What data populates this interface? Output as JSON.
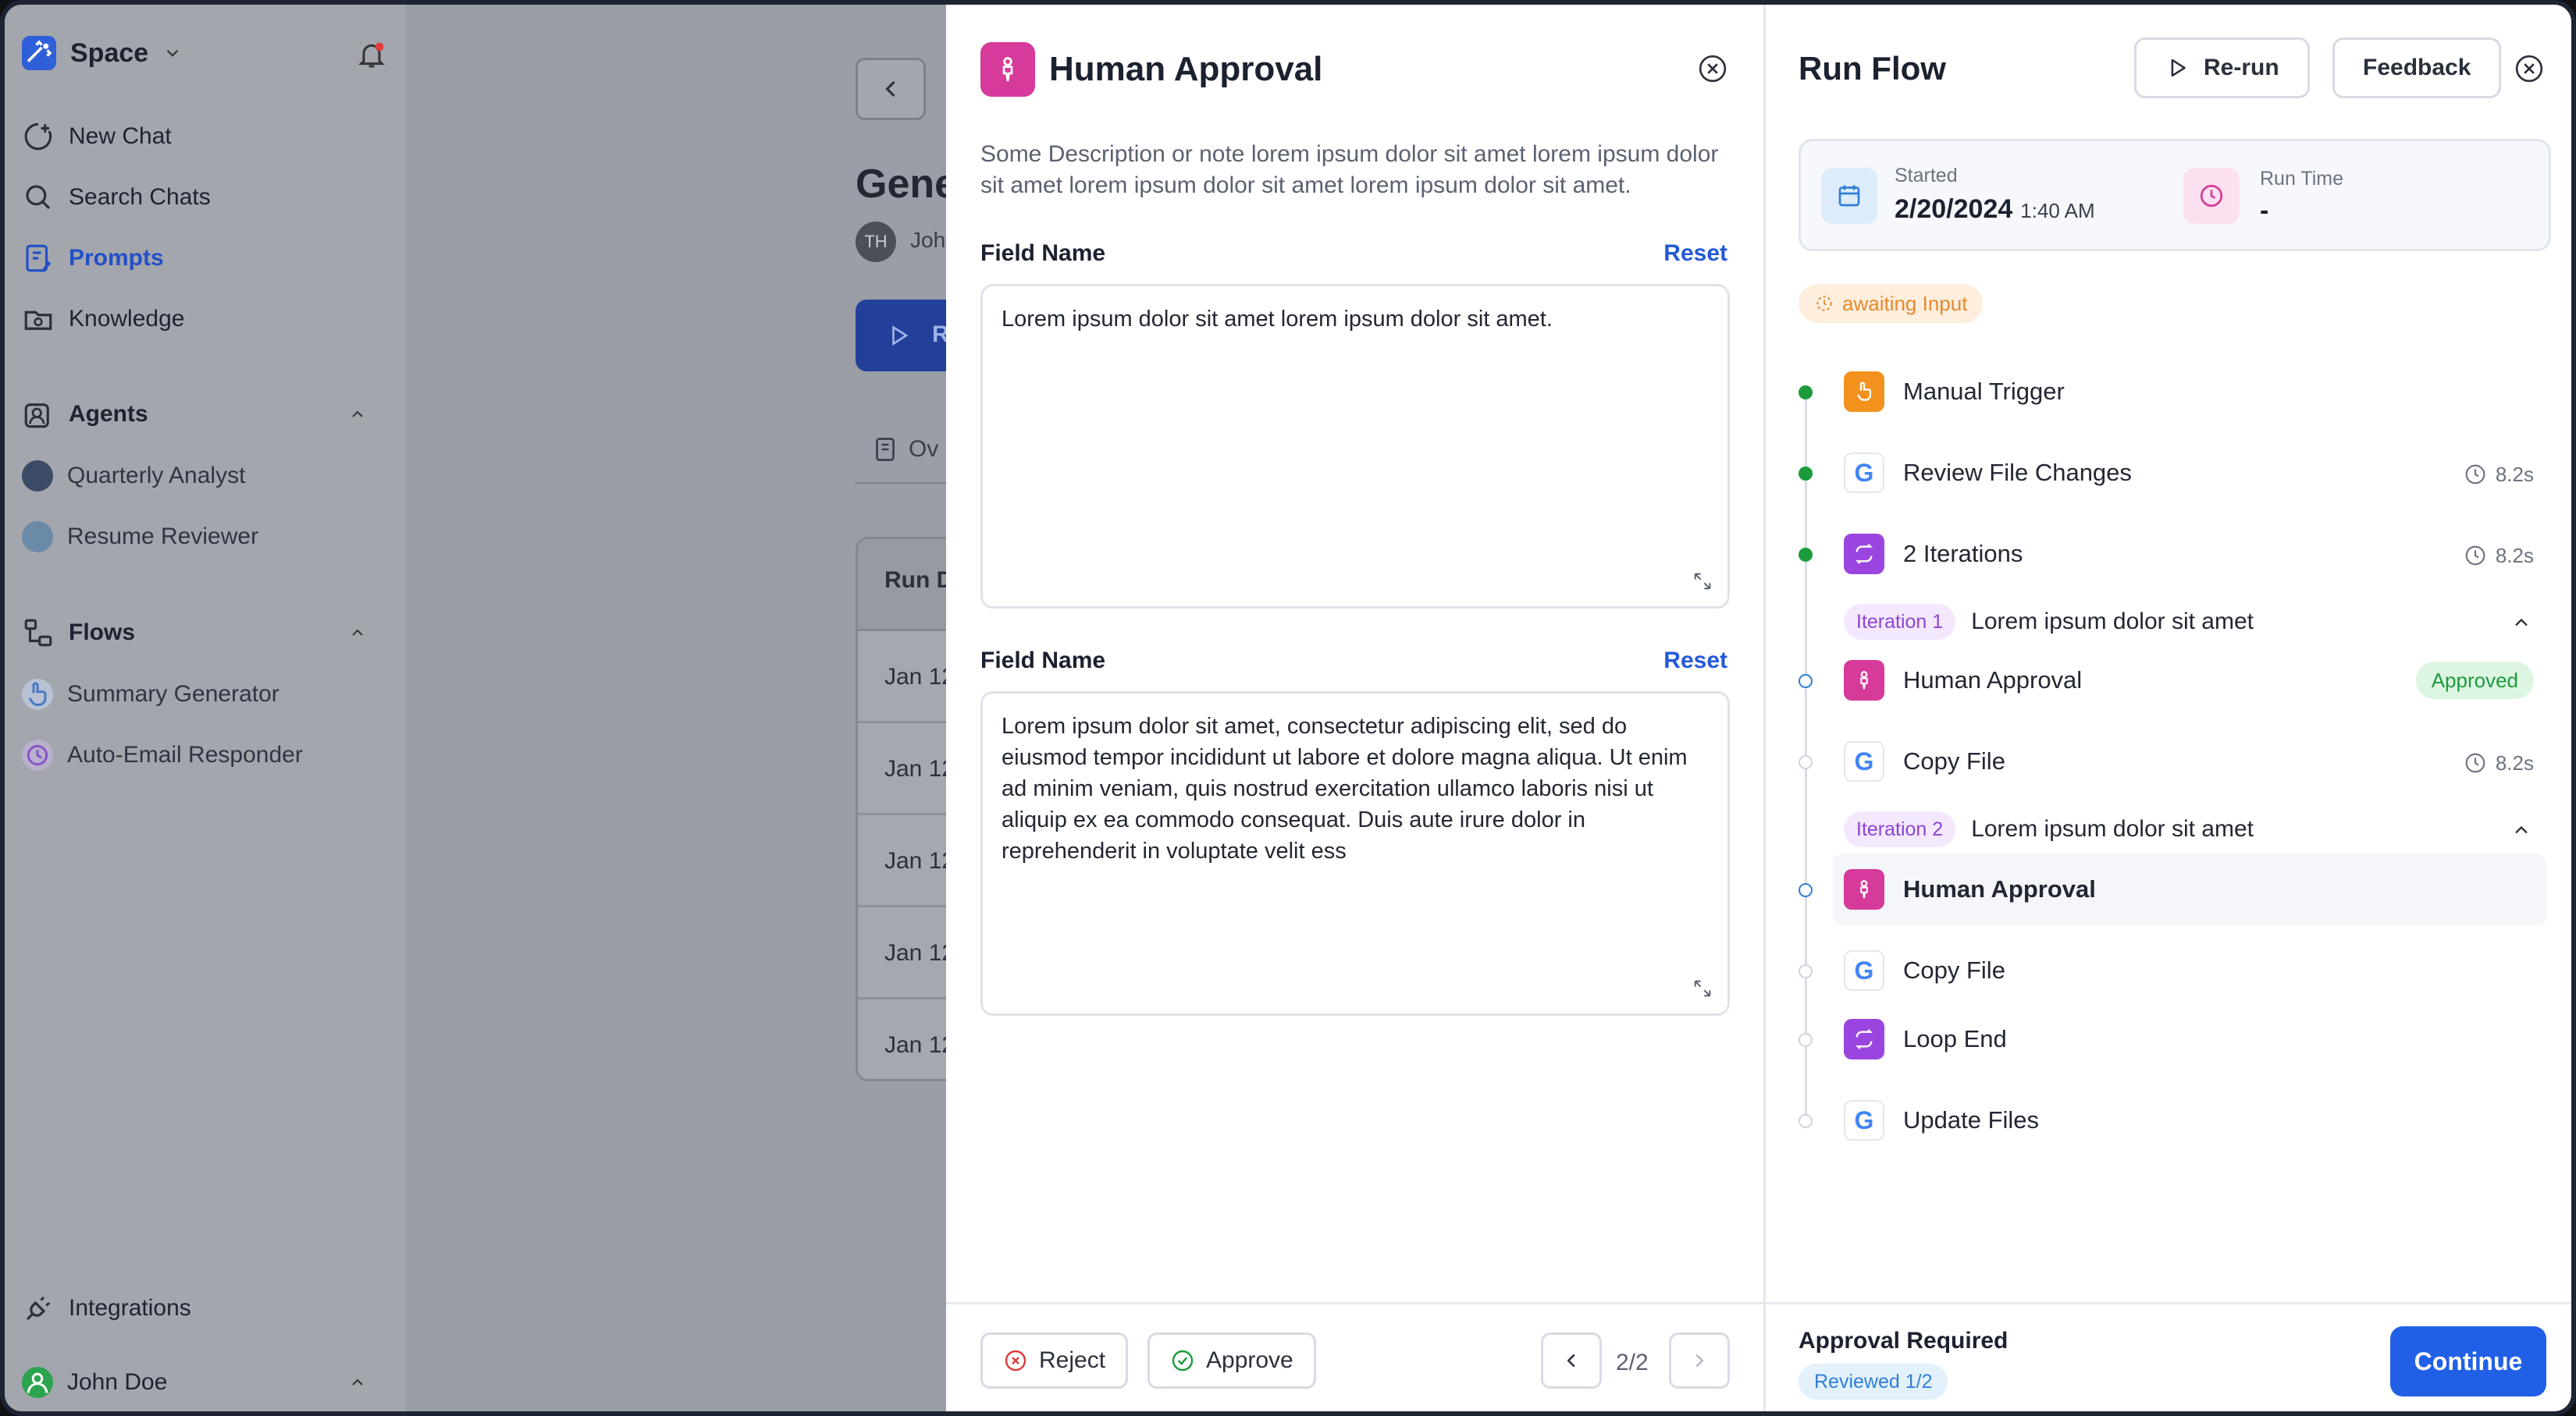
{
  "sidebar": {
    "workspace": "Space",
    "nav": {
      "new_chat": "New Chat",
      "search_chats": "Search Chats",
      "prompts": "Prompts",
      "knowledge": "Knowledge"
    },
    "agents_title": "Agents",
    "agents": [
      "Quarterly Analyst",
      "Resume Reviewer"
    ],
    "flows_title": "Flows",
    "flows": [
      "Summary Generator",
      "Auto-Email Responder"
    ],
    "integrations": "Integrations",
    "user": "John Doe"
  },
  "background": {
    "title_fragment": "Gene",
    "avatar_initials": "TH",
    "owner_fragment": "Joh",
    "run_fragment": "R",
    "tab_fragment": "Ov",
    "table_header_fragment": "Run D",
    "rows": [
      "Jan 12",
      "Jan 12",
      "Jan 12",
      "Jan 12",
      "Jan 12"
    ]
  },
  "approval_panel": {
    "title": "Human Approval",
    "description": "Some Description or note lorem ipsum dolor sit amet lorem ipsum dolor sit amet lorem ipsum dolor sit amet lorem ipsum dolor sit amet.",
    "fields": [
      {
        "label": "Field Name",
        "reset": "Reset",
        "value": "Lorem ipsum dolor sit amet lorem ipsum dolor sit amet."
      },
      {
        "label": "Field Name",
        "reset": "Reset",
        "value": "Lorem ipsum dolor sit amet, consectetur adipiscing elit, sed do eiusmod tempor incididunt ut labore et dolore magna aliqua. Ut enim ad minim veniam, quis nostrud exercitation ullamco laboris nisi ut aliquip ex ea commodo consequat. Duis aute irure dolor in reprehenderit in voluptate velit ess"
      }
    ],
    "reject": "Reject",
    "approve": "Approve",
    "pager": "2/2"
  },
  "run_flow": {
    "title": "Run Flow",
    "rerun": "Re-run",
    "feedback": "Feedback",
    "started_label": "Started",
    "started_date": "2/20/2024",
    "started_time": "1:40 AM",
    "runtime_label": "Run Time",
    "runtime_value": "-",
    "status": "awaiting Input",
    "steps": {
      "manual_trigger": "Manual Trigger",
      "review_file_changes": "Review File Changes",
      "review_duration": "8.2s",
      "iterations": "2 Iterations",
      "iterations_duration": "8.2s",
      "iter1_tag": "Iteration 1",
      "iter1_text": "Lorem ipsum dolor sit amet",
      "iter1_approval": "Human Approval",
      "iter1_approved": "Approved",
      "iter1_copy": "Copy File",
      "iter1_copy_duration": "8.2s",
      "iter2_tag": "Iteration 2",
      "iter2_text": "Lorem ipsum dolor sit amet",
      "iter2_approval": "Human Approval",
      "iter2_copy": "Copy File",
      "loop_end": "Loop End",
      "update_files": "Update Files"
    },
    "footer_title": "Approval Required",
    "reviewed": "Reviewed 1/2",
    "continue": "Continue"
  },
  "colors": {
    "accent": "#2160e6",
    "pink": "#d63a9a",
    "purple": "#9b45e0",
    "orange": "#f2921d",
    "green": "#1a9c3c"
  }
}
